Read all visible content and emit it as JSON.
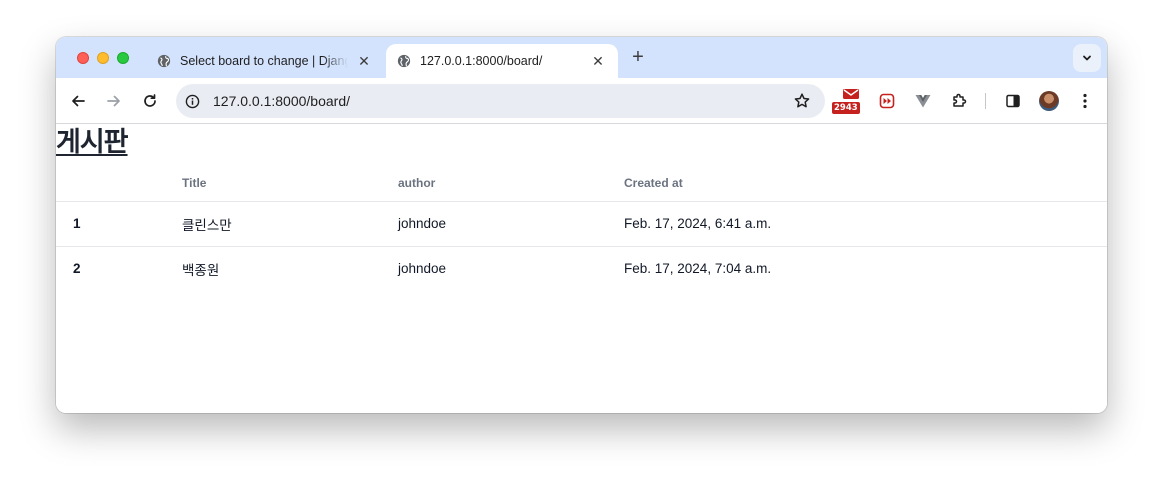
{
  "browser": {
    "tabs": [
      {
        "title": "Select board to change | Django site admin",
        "active": false
      },
      {
        "title": "127.0.0.1:8000/board/",
        "active": true
      }
    ],
    "new_tab_label": "+",
    "url": "127.0.0.1:8000/board/",
    "extensions": {
      "mail_badge_count": "2943"
    },
    "colors": {
      "tabstrip": "#d3e3fd",
      "omnibox": "#e9ecf3",
      "close_red": "#fe5f57",
      "minimize_yellow": "#febc2e",
      "zoom_green": "#28c840"
    }
  },
  "page": {
    "heading": "게시판",
    "table": {
      "columns": [
        "",
        "Title",
        "author",
        "Created at"
      ],
      "rows": [
        {
          "id": "1",
          "title": "클린스만",
          "author": "johndoe",
          "created_at": "Feb. 17, 2024, 6:41 a.m."
        },
        {
          "id": "2",
          "title": "백종원",
          "author": "johndoe",
          "created_at": "Feb. 17, 2024, 7:04 a.m."
        }
      ]
    }
  }
}
